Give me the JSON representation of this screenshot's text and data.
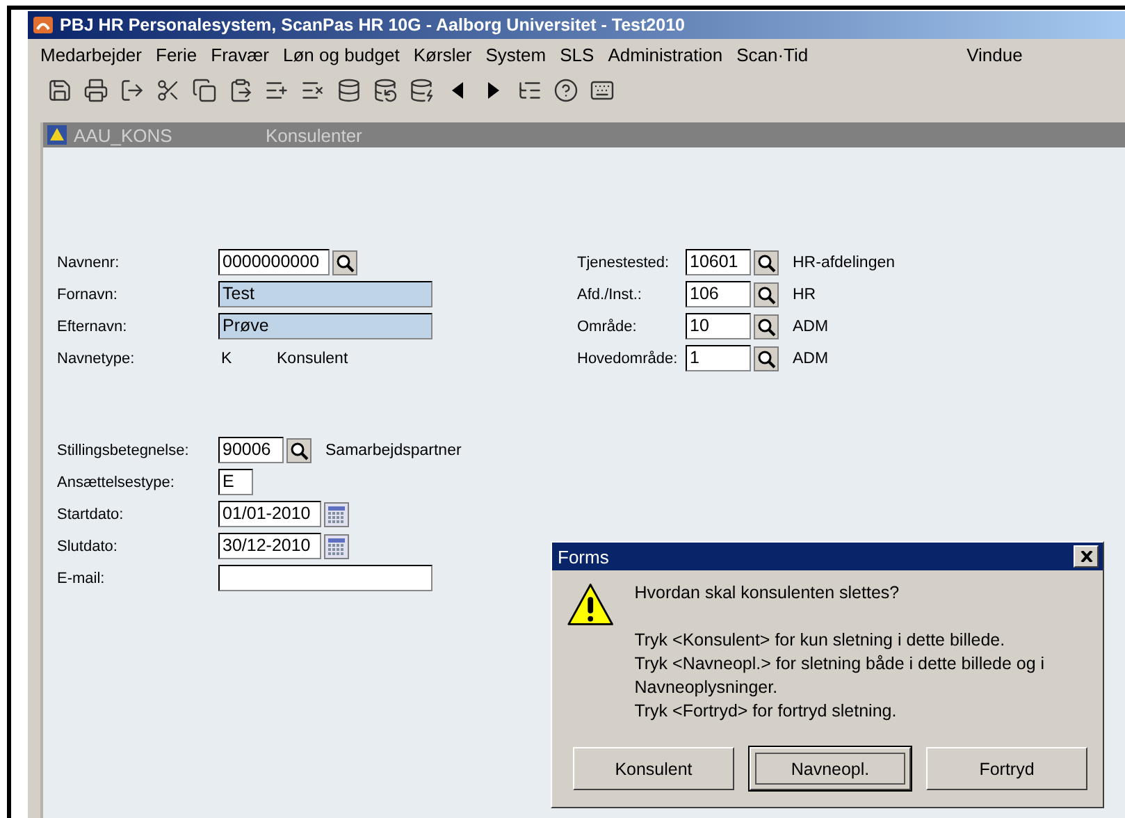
{
  "window": {
    "title": "PBJ HR Personalesystem, ScanPas HR 10G  -  Aalborg Universitet - Test2010"
  },
  "menu": [
    {
      "label": "Medarbejder"
    },
    {
      "label": "Ferie"
    },
    {
      "label": "Fravær"
    },
    {
      "label": "Løn og budget"
    },
    {
      "label": "Kørsler"
    },
    {
      "label": "System"
    },
    {
      "label": "SLS"
    },
    {
      "label": "Administration"
    },
    {
      "label": "Scan·Tid"
    },
    {
      "label": "Vindue",
      "kind": "right"
    }
  ],
  "form_header": {
    "code": "AAU_KONS",
    "title": "Konsulenter"
  },
  "identity": [
    {
      "label": "Navnenr:",
      "kind": "lookup",
      "value": "0000000000",
      "highlighted": false
    },
    {
      "label": "Fornavn:",
      "kind": "field",
      "value": "Test",
      "highlighted": true
    },
    {
      "label": "Efternavn:",
      "kind": "field",
      "value": "Prøve",
      "highlighted": true
    },
    {
      "label": "Navnetype:",
      "kind": "static",
      "value": "K",
      "description": "Konsulent"
    }
  ],
  "organisation": [
    {
      "label": "Tjenestested:",
      "kind": "lookup",
      "value": "10601",
      "description": "HR-afdelingen",
      "highlighted": false
    },
    {
      "label": "Afd./Inst.:",
      "kind": "lookup",
      "value": "106",
      "description": "HR",
      "highlighted": false
    },
    {
      "label": "Område:",
      "kind": "lookup",
      "value": "10",
      "description": "ADM",
      "highlighted": false
    },
    {
      "label": "Hovedområde:",
      "kind": "lookup",
      "value": "1",
      "description": "ADM",
      "highlighted": false
    }
  ],
  "employment": [
    {
      "label": "Stillingsbetegnelse:",
      "kind": "lookup",
      "value": "90006",
      "description": "Samarbejdspartner",
      "highlighted": false
    },
    {
      "label": "Ansættelsestype:",
      "kind": "field",
      "value": "E",
      "highlighted": false
    },
    {
      "label": "Startdato:",
      "kind": "date",
      "value": "01/01-2010",
      "highlighted": false
    },
    {
      "label": "Slutdato:",
      "kind": "date",
      "value": "30/12-2010",
      "highlighted": false
    },
    {
      "label": "E-mail:",
      "kind": "field",
      "highlighted": false
    }
  ],
  "dialog": {
    "title": "Forms",
    "question": "Hvordan skal konsulenten slettes?",
    "messages": [
      "Tryk <Konsulent> for kun sletning i dette billede.",
      "Tryk <Navneopl.> for sletning både i dette billede og i Navneoplysninger.",
      "Tryk <Fortryd> for fortryd sletning."
    ],
    "buttons": [
      {
        "label": "Konsulent",
        "focused": false
      },
      {
        "label": "Navneopl.",
        "focused": true
      },
      {
        "label": "Fortryd",
        "focused": false
      }
    ]
  }
}
